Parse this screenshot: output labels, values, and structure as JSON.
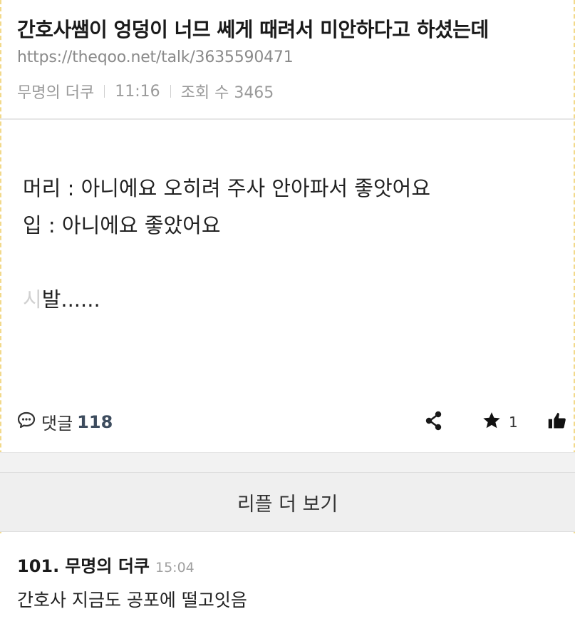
{
  "post": {
    "title": "간호사쌤이 엉덩이 너므 쎄게 때려서 미안하다고 하셨는데",
    "url": "https://theqoo.net/talk/3635590471",
    "author": "무명의 더쿠",
    "time": "11:16",
    "views_label": "조회 수 3465",
    "content": {
      "line1": "머리 : 아니에요 오히려 주사 안아파서 좋앗어요",
      "line2": "입 : 아니에요 좋았어요",
      "line3_muted": "시",
      "line3_rest": "발......"
    }
  },
  "actions": {
    "comment_label": "댓글",
    "comment_count": "118",
    "star_count": "1",
    "icons": [
      "comment-icon",
      "share-icon",
      "star-icon",
      "thumbs-up-icon"
    ]
  },
  "more_replies": {
    "label": "리플 더 보기"
  },
  "reply": {
    "number": "101.",
    "author": "무명의 더쿠",
    "time": "15:04",
    "body": "간호사 지금도 공포에 떨고잇음"
  },
  "colors": {
    "accent_count": "#3d4c5e",
    "muted_text": "#9a9a9a",
    "button_bg": "#efefef"
  }
}
